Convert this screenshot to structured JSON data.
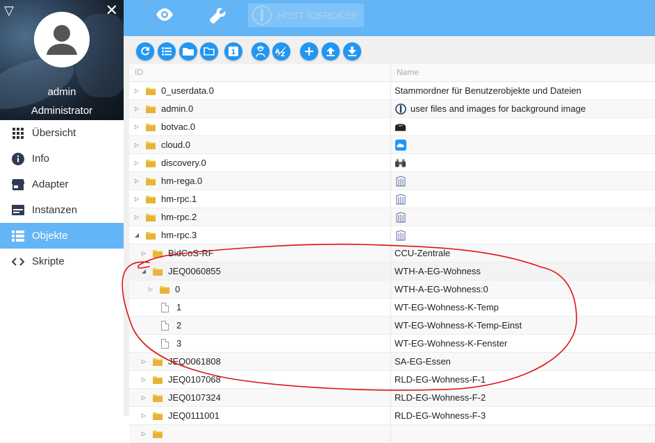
{
  "sidebar": {
    "user_name": "admin",
    "user_role": "Administrator",
    "items": [
      {
        "label": "Übersicht",
        "icon": "apps-grid-icon"
      },
      {
        "label": "Info",
        "icon": "info-icon"
      },
      {
        "label": "Adapter",
        "icon": "store-icon"
      },
      {
        "label": "Instanzen",
        "icon": "instances-icon"
      },
      {
        "label": "Objekte",
        "icon": "list-icon",
        "active": true
      },
      {
        "label": "Skripte",
        "icon": "code-icon"
      }
    ]
  },
  "topbar": {
    "host_label": "HOST IOBROKER"
  },
  "table": {
    "col_id": "ID",
    "col_name": "Name",
    "rows": [
      {
        "id": "0_userdata.0",
        "name": "Stammordner für Benutzerobjekte und Dateien",
        "icon": "",
        "level": 0,
        "kind": "folder",
        "state": "collapsed"
      },
      {
        "id": "admin.0",
        "name": "user files and images for background image",
        "icon": "iobroker-logo-icon",
        "level": 0,
        "kind": "folder",
        "state": "collapsed"
      },
      {
        "id": "botvac.0",
        "name": "",
        "icon": "robot-vacuum-icon",
        "level": 0,
        "kind": "folder",
        "state": "collapsed"
      },
      {
        "id": "cloud.0",
        "name": "",
        "icon": "cloud-icon",
        "level": 0,
        "kind": "folder",
        "state": "collapsed"
      },
      {
        "id": "discovery.0",
        "name": "",
        "icon": "binoculars-icon",
        "level": 0,
        "kind": "folder",
        "state": "collapsed"
      },
      {
        "id": "hm-rega.0",
        "name": "",
        "icon": "homematic-icon",
        "level": 0,
        "kind": "folder",
        "state": "collapsed"
      },
      {
        "id": "hm-rpc.1",
        "name": "",
        "icon": "homematic-icon",
        "level": 0,
        "kind": "folder",
        "state": "collapsed"
      },
      {
        "id": "hm-rpc.2",
        "name": "",
        "icon": "homematic-icon",
        "level": 0,
        "kind": "folder",
        "state": "collapsed"
      },
      {
        "id": "hm-rpc.3",
        "name": "",
        "icon": "homematic-icon",
        "level": 0,
        "kind": "folder",
        "state": "expanded"
      },
      {
        "id": "BidCoS-RF",
        "name": "CCU-Zentrale",
        "icon": "",
        "level": 1,
        "kind": "folder",
        "state": "collapsed"
      },
      {
        "id": "JEQ0060855",
        "name": "WTH-A-EG-Wohness",
        "icon": "",
        "level": 1,
        "kind": "folder",
        "state": "expanded"
      },
      {
        "id": "0",
        "name": "WTH-A-EG-Wohness:0",
        "icon": "",
        "level": 2,
        "kind": "folder",
        "state": "collapsed"
      },
      {
        "id": "1",
        "name": "WT-EG-Wohness-K-Temp",
        "icon": "",
        "level": 2,
        "kind": "file",
        "state": "none"
      },
      {
        "id": "2",
        "name": "WT-EG-Wohness-K-Temp-Einst",
        "icon": "",
        "level": 2,
        "kind": "file",
        "state": "none"
      },
      {
        "id": "3",
        "name": "WT-EG-Wohness-K-Fenster",
        "icon": "",
        "level": 2,
        "kind": "file",
        "state": "none"
      },
      {
        "id": "JEQ0061808",
        "name": "SA-EG-Essen",
        "icon": "",
        "level": 1,
        "kind": "folder",
        "state": "collapsed"
      },
      {
        "id": "JEQ0107068",
        "name": "RLD-EG-Wohness-F-1",
        "icon": "",
        "level": 1,
        "kind": "folder",
        "state": "collapsed"
      },
      {
        "id": "JEQ0107324",
        "name": "RLD-EG-Wohness-F-2",
        "icon": "",
        "level": 1,
        "kind": "folder",
        "state": "collapsed"
      },
      {
        "id": "JEQ0111001",
        "name": "RLD-EG-Wohness-F-3",
        "icon": "",
        "level": 1,
        "kind": "folder",
        "state": "collapsed"
      },
      {
        "id": "",
        "name": "",
        "icon": "",
        "level": 1,
        "kind": "folder",
        "state": "collapsed"
      }
    ]
  },
  "colors": {
    "accent": "#64b5f6",
    "button": "#2196f3",
    "annotation": "#e01010",
    "folder": "#f2c94c"
  }
}
